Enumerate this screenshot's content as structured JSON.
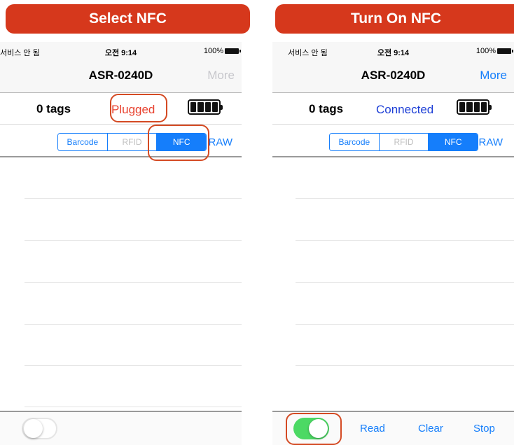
{
  "left": {
    "banner": "Select NFC",
    "status": {
      "carrier": "서비스 안 됨",
      "time": "오전 9:14",
      "battery": "100%"
    },
    "nav": {
      "title": "ASR-0240D",
      "more": "More"
    },
    "tags": {
      "count": "0  tags",
      "connection": "Plugged"
    },
    "segment": {
      "barcode": "Barcode",
      "rfid": "RFID",
      "nfc": "NFC",
      "selected": "NFC"
    },
    "raw": "RAW",
    "toggle_state": "off"
  },
  "right": {
    "banner": "Turn On  NFC",
    "status": {
      "carrier": "서비스 안 됨",
      "time": "오전 9:14",
      "battery": "100%"
    },
    "nav": {
      "title": "ASR-0240D",
      "more": "More"
    },
    "tags": {
      "count": "0  tags",
      "connection": "Connected"
    },
    "segment": {
      "barcode": "Barcode",
      "rfid": "RFID",
      "nfc": "NFC",
      "selected": "NFC"
    },
    "raw": "RAW",
    "toggle_state": "on",
    "toolbar": {
      "read": "Read",
      "clear": "Clear",
      "stop": "Stop"
    }
  },
  "colors": {
    "banner": "#d6381c",
    "ios_blue": "#157efb",
    "plugged_red": "#e8412e",
    "connected_blue": "#1d3fd6",
    "toggle_on": "#4cd964",
    "highlight": "#d44a23"
  },
  "icons": {
    "status_battery": "battery-icon",
    "device_battery": "battery-full-icon"
  }
}
